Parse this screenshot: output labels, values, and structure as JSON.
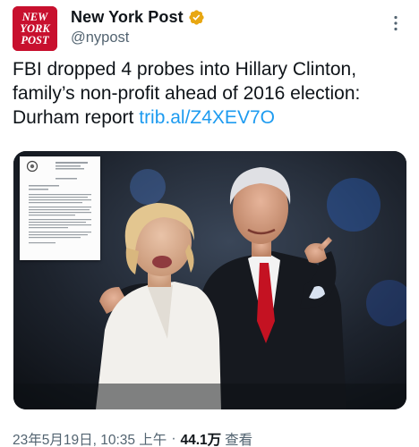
{
  "tweet": {
    "author": {
      "display_name": "New York Post",
      "handle": "@nypost",
      "avatar_text": [
        "NEW",
        "YORK",
        "POST"
      ],
      "verified_color": "#e8a712",
      "avatar_color": "#c8102e"
    },
    "text": "FBI dropped 4 probes into Hillary Clinton, family’s non-profit ahead of 2016 election: Durham report",
    "link": "trib.al/Z4XEV7O",
    "media": {
      "icon": "photo-image"
    },
    "meta": {
      "timestamp": "23年5月19日, 10:35 上午",
      "separator": "·",
      "views_count": "44.1万",
      "views_label": "查看"
    },
    "icons": [
      "verified-badge-icon",
      "more-options-icon"
    ]
  }
}
